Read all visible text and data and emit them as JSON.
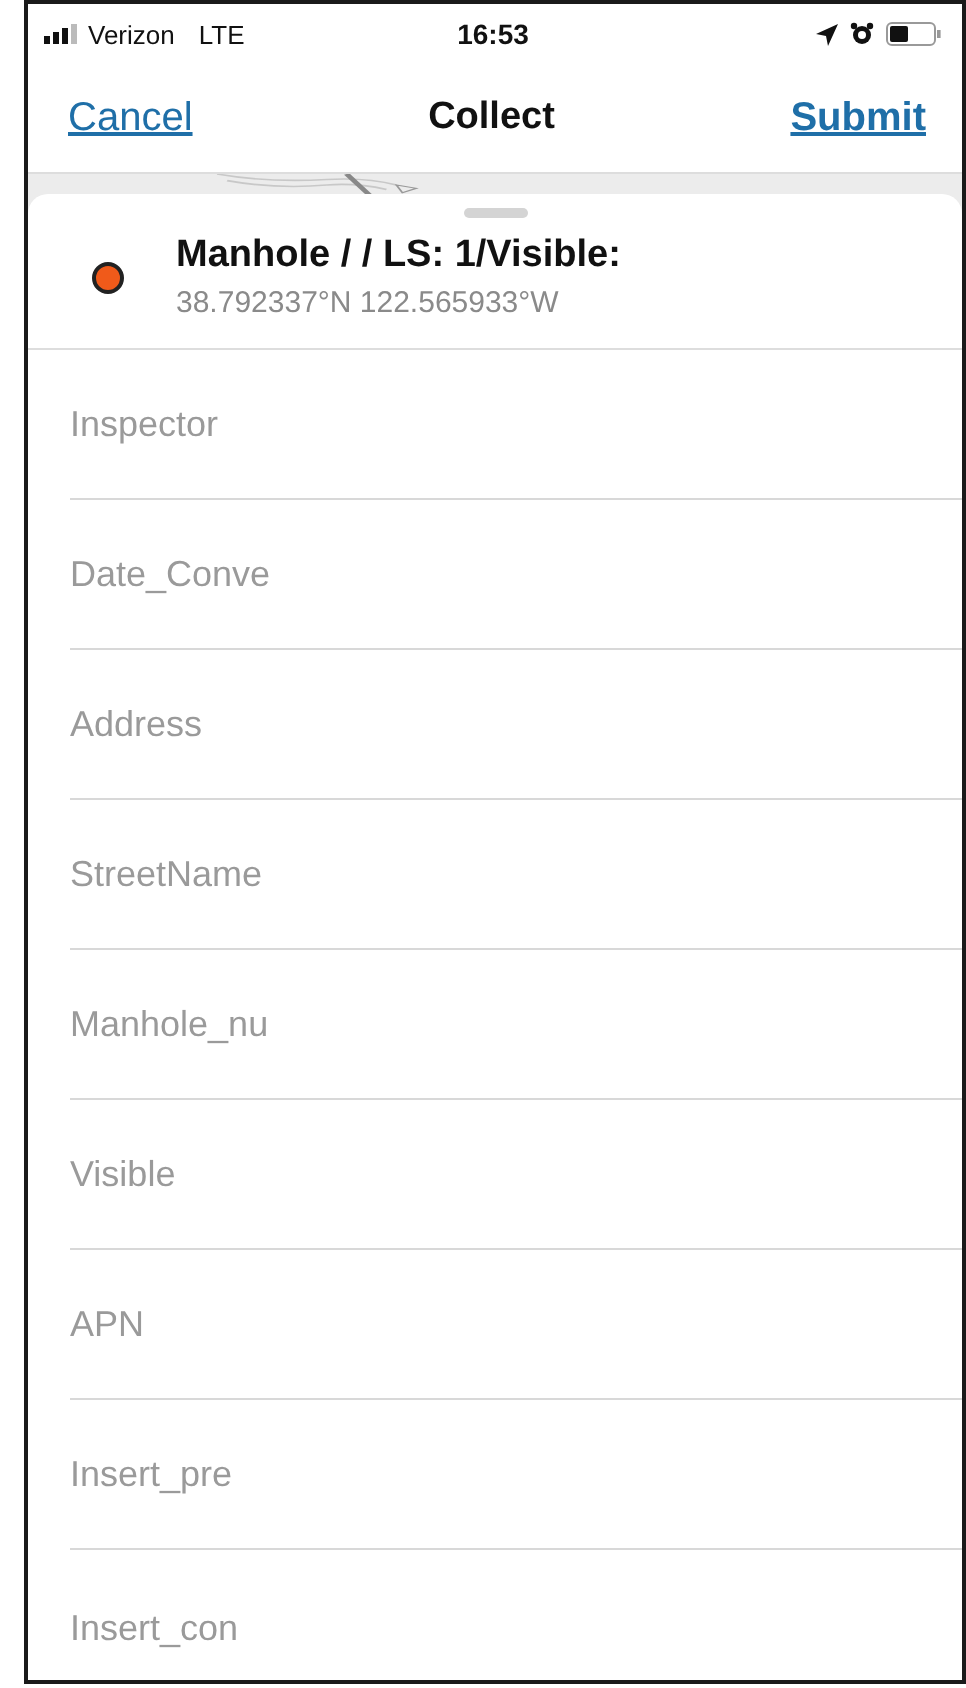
{
  "status_bar": {
    "carrier": "Verizon",
    "network": "LTE",
    "time": "16:53"
  },
  "nav": {
    "cancel": "Cancel",
    "title": "Collect",
    "submit": "Submit"
  },
  "feature": {
    "title": "Manhole / / LS: 1/Visible:",
    "coordinates": "38.792337°N  122.565933°W",
    "color": "#f05a1a"
  },
  "fields": [
    {
      "placeholder": "Inspector"
    },
    {
      "placeholder": "Date_Conve"
    },
    {
      "placeholder": "Address"
    },
    {
      "placeholder": "StreetName"
    },
    {
      "placeholder": "Manhole_nu"
    },
    {
      "placeholder": "Visible"
    },
    {
      "placeholder": "APN"
    },
    {
      "placeholder": "Insert_pre"
    },
    {
      "placeholder": "Insert_con"
    }
  ]
}
